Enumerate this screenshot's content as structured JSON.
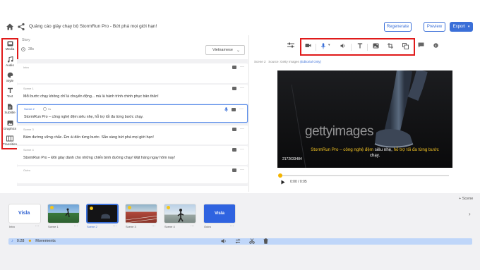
{
  "header": {
    "title": "Quảng cáo giày chạy bộ StormRun Pro - Bứt phá mọi giới hạn!",
    "regenerate_label": "Regenerate",
    "preview_label": "Preview",
    "export_label": "Export"
  },
  "left_toolbar": {
    "items": [
      {
        "label": "Media",
        "icon": "media-icon"
      },
      {
        "label": "Audio",
        "icon": "music-note-icon"
      },
      {
        "label": "Style",
        "icon": "palette-icon"
      },
      {
        "label": "Text",
        "icon": "text-icon"
      },
      {
        "label": "Subtitle",
        "icon": "subtitle-icon"
      },
      {
        "label": "Graphics",
        "icon": "graphics-icon"
      },
      {
        "label": "Transition",
        "icon": "transition-icon"
      }
    ]
  },
  "script": {
    "story_label": "Story",
    "duration": "28s",
    "language": "Vietnamese",
    "scenes": [
      {
        "name": "Intro",
        "text": ""
      },
      {
        "name": "Scene 1",
        "text": "Mỗi bước chạy không chỉ là chuyến động... mà là hành trình chinh phục bản thân!"
      },
      {
        "name": "Scene 2",
        "duration": "5s",
        "text": "StormRun Pro – công nghệ đệm siêu nhẹ, hỗ trợ tối đa từng bước chạy."
      },
      {
        "name": "Scene 3",
        "text": "Bám đường vững chắc. Êm ái đến từng bước. Sẵn sàng bứt phá mọi giới hạn!"
      },
      {
        "name": "Scene 4",
        "text": "StormRun Pro – Đôi giày dành cho những chiến binh đường chạy! Đặt hàng ngay hôm nay!"
      },
      {
        "name": "Outro",
        "text": ""
      }
    ]
  },
  "preview": {
    "scene_label": "Scene 2",
    "source_label": "Source: Getty Images",
    "source_note": "(Editorial Only)",
    "watermark": "gettyimages",
    "caption_highlight": "StormRun Pro – công nghệ đệm",
    "caption_white": "siêu nhẹ,",
    "caption_highlight2": "hỗ trợ tối đa từng bước",
    "caption_line2": "chạy.",
    "video_id": "2172633484",
    "time": "0:00 / 0:05",
    "progress": 0.0
  },
  "timeline": {
    "add_scene_label": "Scene",
    "thumbnails": [
      {
        "label": "Intro",
        "text": "Visla"
      },
      {
        "label": "Scene 1"
      },
      {
        "label": "Scene 2"
      },
      {
        "label": "Scene 3"
      },
      {
        "label": "Scene 4"
      },
      {
        "label": "Outro",
        "text": "Visla"
      }
    ],
    "music_duration": "0:28",
    "music_title": "Movements"
  },
  "colors": {
    "accent": "#3a6fd8",
    "highlight_box": "#e01a1a",
    "caption_yellow": "#f3c423"
  }
}
